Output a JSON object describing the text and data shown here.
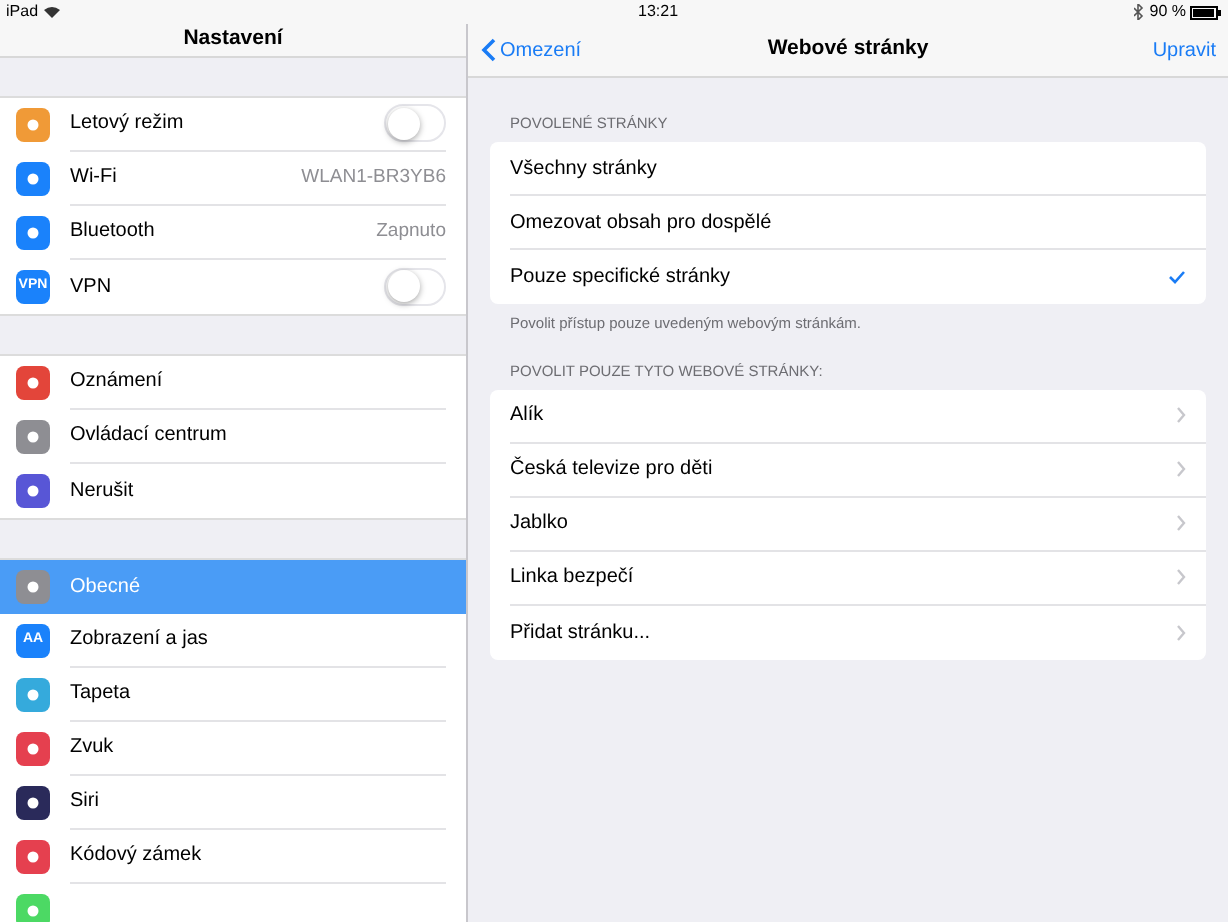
{
  "status_bar": {
    "device": "iPad",
    "time": "13:21",
    "battery": "90 %"
  },
  "sidebar": {
    "title": "Nastavení",
    "groups": [
      [
        {
          "label": "Letový režim",
          "kind": "toggle",
          "on": false,
          "color": "#f09a37"
        },
        {
          "label": "Wi-Fi",
          "kind": "value",
          "value": "WLAN1-BR3YB6",
          "color": "#1a82fb"
        },
        {
          "label": "Bluetooth",
          "kind": "value",
          "value": "Zapnuto",
          "color": "#1a82fb"
        },
        {
          "label": "VPN",
          "kind": "toggle",
          "on": false,
          "color": "#1a82fb",
          "icon_text": "VPN"
        }
      ],
      [
        {
          "label": "Oznámení",
          "kind": "plain",
          "color": "#e3453a"
        },
        {
          "label": "Ovládací centrum",
          "kind": "plain",
          "color": "#8e8e93"
        },
        {
          "label": "Nerušit",
          "kind": "plain",
          "color": "#5856d6"
        }
      ],
      [
        {
          "label": "Obecné",
          "kind": "plain",
          "color": "#8e8e93",
          "selected": true
        },
        {
          "label": "Zobrazení a jas",
          "kind": "plain",
          "color": "#1a82fb",
          "icon_text": "AA",
          "selected": false
        },
        {
          "label": "Tapeta",
          "kind": "plain",
          "color": "#35aadc",
          "selected": false
        },
        {
          "label": "Zvuk",
          "kind": "plain",
          "color": "#e5404f",
          "selected": false
        },
        {
          "label": "Siri",
          "kind": "plain",
          "color": "#2a2a5a",
          "selected": false
        },
        {
          "label": "Kódový zámek",
          "kind": "plain",
          "color": "#e5404f",
          "selected": false
        },
        {
          "kind": "plain",
          "color": "#4cd964",
          "selected": false
        }
      ]
    ]
  },
  "detail": {
    "back": "Omezení",
    "title": "Webové stránky",
    "action": "Upravit",
    "sections": [
      {
        "header": "POVOLENÉ STRÁNKY",
        "kind": "choice",
        "rows": [
          {
            "label": "Všechny stránky",
            "selected": false
          },
          {
            "label": "Omezovat obsah pro dospělé",
            "selected": false
          },
          {
            "label": "Pouze specifické stránky",
            "selected": true
          }
        ],
        "footer": "Povolit přístup pouze uvedeným webovým stránkám."
      },
      {
        "header": "POVOLIT POUZE TYTO WEBOVÉ STRÁNKY:",
        "kind": "link",
        "rows": [
          {
            "label": "Alík"
          },
          {
            "label": "Česká televize pro děti"
          },
          {
            "label": "Jablko"
          },
          {
            "label": "Linka bezpečí"
          },
          {
            "label": "Přidat stránku..."
          }
        ]
      }
    ]
  }
}
